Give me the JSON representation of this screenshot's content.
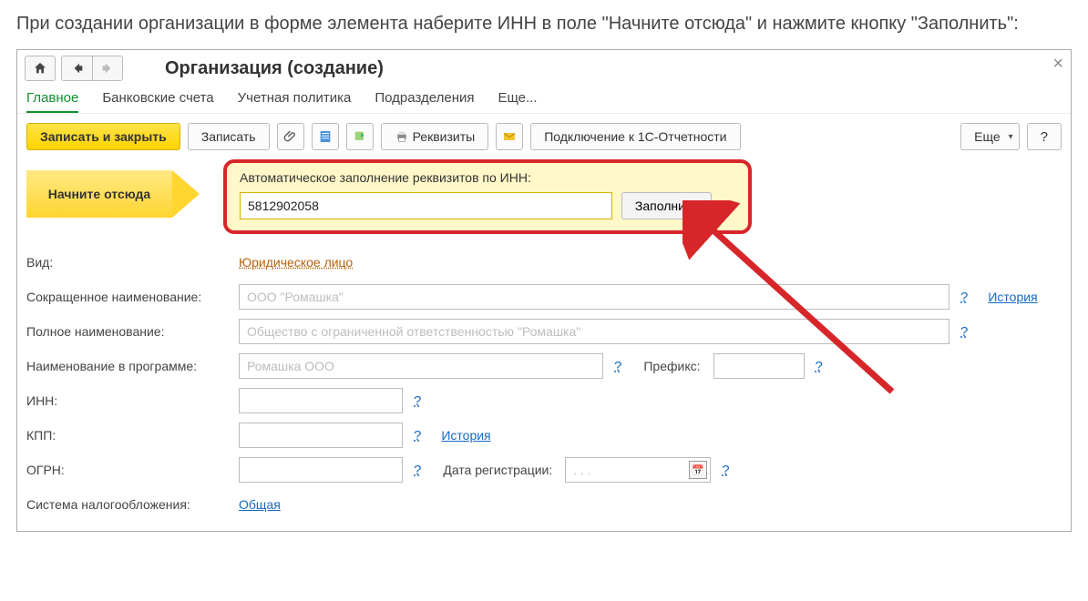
{
  "intro": "При создании организации в форме элемента наберите ИНН в поле \"Начните отсюда\" и нажмите кнопку \"Заполнить\":",
  "window": {
    "title": "Организация (создание)"
  },
  "tabs": {
    "main": "Главное",
    "bank": "Банковские счета",
    "policy": "Учетная политика",
    "divisions": "Подразделения",
    "more": "Еще..."
  },
  "toolbar": {
    "write_close": "Записать и закрыть",
    "write": "Записать",
    "rekvizity": "Реквизиты",
    "connect1c": "Подключение к 1С-Отчетности",
    "more": "Еще",
    "help": "?"
  },
  "autofill": {
    "start_here": "Начните отсюда",
    "caption": "Автоматическое заполнение реквизитов по ИНН:",
    "inn_value": "5812902058",
    "fill": "Заполнить",
    "help": "?"
  },
  "form": {
    "vid_label": "Вид:",
    "vid_value": "Юридическое лицо",
    "short_name_label": "Сокращенное наименование:",
    "short_name_placeholder": "ООО \"Ромашка\"",
    "full_name_label": "Полное наименование:",
    "full_name_placeholder": "Общество с ограниченной ответственностью \"Ромашка\"",
    "prog_name_label": "Наименование в программе:",
    "prog_name_placeholder": "Ромашка ООО",
    "prefix_label": "Префикс:",
    "inn_label": "ИНН:",
    "kpp_label": "КПП:",
    "ogrn_label": "ОГРН:",
    "reg_date_label": "Дата регистрации:",
    "reg_date_placeholder": ". . .",
    "tax_system_label": "Система налогообложения:",
    "tax_system_value": "Общая",
    "history": "История",
    "qmark": "?"
  }
}
